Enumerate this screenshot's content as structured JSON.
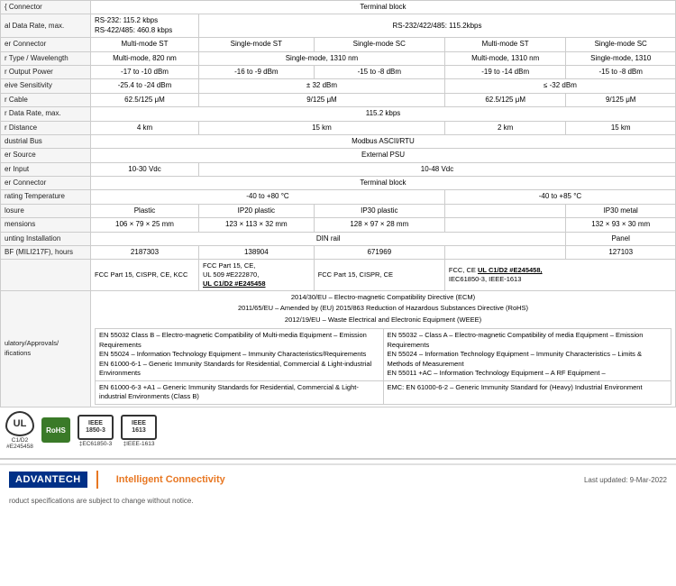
{
  "table": {
    "rows": [
      {
        "label": "{ Connector",
        "values": [
          "Terminal block",
          "",
          "",
          "",
          ""
        ]
      },
      {
        "label": "al Data Rate, max.",
        "values": [
          "RS-232: 115.2 kbps\nRS-422/485: 460.8 kbps",
          "RS-232/422/485: 115.2kbps",
          "",
          "",
          ""
        ]
      },
      {
        "label": "er Connector",
        "values": [
          "Multi-mode ST",
          "Single-mode ST",
          "Single-mode SC",
          "Multi-mode ST",
          "Single-mode SC"
        ]
      },
      {
        "label": "r Type / Wavelength",
        "values": [
          "Multi-mode, 820 nm",
          "Single-mode, 1310 nm",
          "",
          "Multi-mode, 1310 nm",
          "Single-mode, 1310"
        ]
      },
      {
        "label": "r Output Power",
        "values": [
          "-17 to -10 dBm",
          "-16 to -9 dBm",
          "-15 to -8 dBm",
          "-19 to -14 dBm",
          "-15 to -8 dBm"
        ]
      },
      {
        "label": "eive Sensitivity",
        "values": [
          "-25.4 to -24 dBm",
          "± 32 dBm",
          "",
          "≤ -32 dBm",
          ""
        ]
      },
      {
        "label": "r Cable",
        "values": [
          "62.5/125 μM",
          "9/125 μM",
          "",
          "62.5/125 μM",
          "9/125 μM"
        ]
      },
      {
        "label": "r Data Rate, max.",
        "values": [
          "115.2 kbps",
          "",
          "",
          "",
          ""
        ]
      },
      {
        "label": "r Distance",
        "values": [
          "4 km",
          "15 km",
          "",
          "2 km",
          "15 km"
        ]
      },
      {
        "label": "dustrial Bus",
        "values": [
          "Modbus ASCII/RTU",
          "",
          "",
          "",
          ""
        ]
      },
      {
        "label": "er Source",
        "values": [
          "External PSU",
          "",
          "",
          "",
          ""
        ]
      },
      {
        "label": "er Input",
        "values": [
          "10-30 Vdc",
          "10-48 Vdc",
          "",
          "",
          ""
        ]
      },
      {
        "label": "er Connector",
        "values": [
          "Terminal block",
          "",
          "",
          "",
          ""
        ]
      },
      {
        "label": "rating Temperature",
        "values": [
          "-40 to +80 °C",
          "-40 to +85 °C",
          "",
          "",
          ""
        ]
      },
      {
        "label": "losure",
        "values": [
          "Plastic",
          "IP20 plastic",
          "IP30 plastic",
          "",
          "IP30 metal"
        ]
      },
      {
        "label": "mensions",
        "values": [
          "106 × 79 × 25 mm",
          "123 × 113 × 32 mm",
          "128 × 97 × 28 mm",
          "",
          "132 × 93 × 30 mm"
        ]
      },
      {
        "label": "unting Installation",
        "values": [
          "DIN rail",
          "",
          "",
          "",
          "Panel"
        ]
      },
      {
        "label": "BF (MILI217F), hours",
        "values": [
          "2187303",
          "138904",
          "671969",
          "",
          "127103"
        ]
      },
      {
        "label": "",
        "values": [
          "FCC Part 15, CISPR, CE, KCC",
          "FCC Part 15, CE, UL 509 #E222870, UL C1/D2 #E245458",
          "FCC Part 15, CISPR, CE",
          "FCC, CE UL C1/D2 #E245458, IEC61850-3, IEEE-1613",
          ""
        ]
      }
    ],
    "regulations": {
      "directives": [
        "2014/30/EU – Electro-magnetic Compatibility Directive (ECM)",
        "2011/65/EU – Amended by (EU) 2015/863 Reduction of Hazardous Substances Directive (RoHS)",
        "2012/19/EU – Waste Electrical and Electronic Equipment (WEEE)"
      ],
      "en_standards": "EN 55032 Class B – Electro-magnetic Compatibility of Multi-media Equipment – Emission Requirements\nEN 55024 – Information Technology Equipment – Immunity Characteristics/Requirements\nEN 61000-6-1 – Generic Immunity Standards for Residential, Commercial & Light-industrial Environments",
      "right_standards": "EN 55032 – Class A – Electro-magnetic Compatibility of media Equipment – Emission Requirements\nEN 55024 – Information Technology Equipment – Immunity Characteristics – Limits & Methods of Measurement\nEN 55011 +AC – Information Technology Equipment – A RF Equipment –",
      "class_b_note": "EN 61000-6-3 +A1 – Generic Immunity Standards for Residential, Commercial & Light-industrial Environments (Class B)",
      "emc_note": "EMC: EN 61000-6-2 – Generic Immunity Standard for (Heavy) Industrial Environment"
    }
  },
  "certifications": [
    {
      "id": "cert-ul",
      "label": "C1/D2\n#E245458",
      "type": "text"
    },
    {
      "id": "cert-rohs",
      "label": "RoHS",
      "type": "rohs"
    },
    {
      "id": "cert-ieee1850",
      "label": "‡EC61850-3",
      "type": "text-small"
    },
    {
      "id": "cert-ieee1613",
      "label": "‡IEEE-1613",
      "type": "text-small"
    }
  ],
  "footer": {
    "logo": "ADVANTECH",
    "tagline": "Intelligent Connectivity",
    "note": "roduct specifications are subject to change without notice.",
    "date_label": "Last updated: 9-Mar-2022"
  }
}
